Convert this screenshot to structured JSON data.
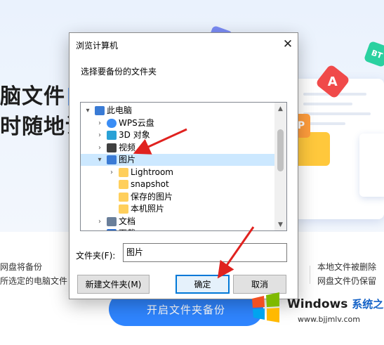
{
  "background": {
    "headline_line1_a": "脑文件",
    "headline_line1_b": "自",
    "headline_line2": "时随地访",
    "feature_left_line1": "网盘将备份",
    "feature_left_line2": "所选定的电脑文件",
    "feature_right_line1": "本地文件被删除",
    "feature_right_line2": "网盘文件仍保留",
    "cta_label": "开启文件夹备份",
    "deco_red_glyph": "A",
    "deco_orange_glyph": "P",
    "deco_teal_glyph": "BT"
  },
  "dialog": {
    "title": "浏览计算机",
    "close_glyph": "✕",
    "description": "选择要备份的文件夹",
    "tree": [
      {
        "label": "此电脑",
        "expander": "▾",
        "icon": "computer-icon",
        "level": 0
      },
      {
        "label": "WPS云盘",
        "expander": "›",
        "icon": "cloud-icon",
        "level": 1
      },
      {
        "label": "3D 对象",
        "expander": "›",
        "icon": "3d-objects-icon",
        "level": 1
      },
      {
        "label": "视频",
        "expander": "›",
        "icon": "video-icon",
        "level": 1
      },
      {
        "label": "图片",
        "expander": "▾",
        "icon": "pictures-icon",
        "level": 1,
        "selected": true
      },
      {
        "label": "Lightroom",
        "expander": "›",
        "icon": "folder-icon",
        "level": 2
      },
      {
        "label": "snapshot",
        "expander": "",
        "icon": "folder-icon",
        "level": 2
      },
      {
        "label": "保存的图片",
        "expander": "",
        "icon": "folder-icon",
        "level": 2
      },
      {
        "label": "本机照片",
        "expander": "",
        "icon": "folder-icon",
        "level": 2
      },
      {
        "label": "文档",
        "expander": "›",
        "icon": "documents-icon",
        "level": 1
      },
      {
        "label": "下载",
        "expander": "›",
        "icon": "download-icon",
        "level": 1
      }
    ],
    "folder_label": "文件夹(F):",
    "folder_value": "图片",
    "new_folder_button": "新建文件夹(M)",
    "ok_button": "确定",
    "cancel_button": "取消"
  },
  "watermark": {
    "title": "Windows",
    "title_cn": "系统之家",
    "url": "www.bjjmlv.com"
  },
  "colors": {
    "accent": "#2f85ff",
    "selection": "#cce8ff",
    "primary_border": "#0078d7",
    "arrow": "#e0221f"
  }
}
